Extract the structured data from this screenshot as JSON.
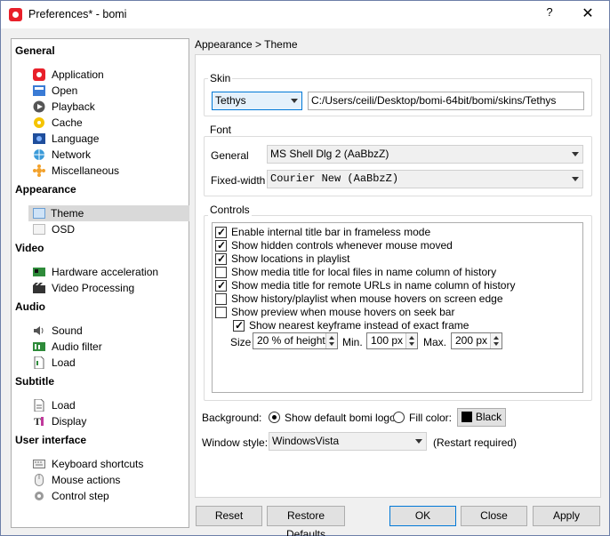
{
  "window": {
    "title": "Preferences* - bomi",
    "help_glyph": "?",
    "close_glyph": "✕"
  },
  "sidebar": {
    "sections": [
      {
        "label": "General",
        "items": [
          {
            "label": "Application",
            "icon": "application-icon"
          },
          {
            "label": "Open",
            "icon": "open-icon"
          },
          {
            "label": "Playback",
            "icon": "playback-icon"
          },
          {
            "label": "Cache",
            "icon": "cache-icon"
          },
          {
            "label": "Language",
            "icon": "language-icon"
          },
          {
            "label": "Network",
            "icon": "network-icon"
          },
          {
            "label": "Miscellaneous",
            "icon": "miscellaneous-icon"
          }
        ]
      },
      {
        "label": "Appearance",
        "items": [
          {
            "label": "Theme",
            "icon": "theme-icon",
            "selected": true
          },
          {
            "label": "OSD",
            "icon": "osd-icon"
          }
        ]
      },
      {
        "label": "Video",
        "items": [
          {
            "label": "Hardware acceleration",
            "icon": "hardware-acceleration-icon"
          },
          {
            "label": "Video Processing",
            "icon": "video-processing-icon"
          }
        ]
      },
      {
        "label": "Audio",
        "items": [
          {
            "label": "Sound",
            "icon": "sound-icon"
          },
          {
            "label": "Audio filter",
            "icon": "audio-filter-icon"
          },
          {
            "label": "Load",
            "icon": "audio-load-icon"
          }
        ]
      },
      {
        "label": "Subtitle",
        "items": [
          {
            "label": "Load",
            "icon": "subtitle-load-icon"
          },
          {
            "label": "Display",
            "icon": "subtitle-display-icon"
          }
        ]
      },
      {
        "label": "User interface",
        "items": [
          {
            "label": "Keyboard shortcuts",
            "icon": "keyboard-icon"
          },
          {
            "label": "Mouse actions",
            "icon": "mouse-icon"
          },
          {
            "label": "Control step",
            "icon": "control-step-icon"
          }
        ]
      }
    ]
  },
  "breadcrumb": "Appearance > Theme",
  "skin": {
    "group_title": "Skin",
    "selected": "Tethys",
    "path": "C:/Users/ceili/Desktop/bomi-64bit/bomi/skins/Tethys"
  },
  "font": {
    "group_title": "Font",
    "general_label": "General",
    "general_value": "MS Shell Dlg 2 (AaBbzZ)",
    "fixed_label": "Fixed-width",
    "fixed_value": "Courier New (AaBbzZ)"
  },
  "controls": {
    "group_title": "Controls",
    "options": [
      {
        "label": "Enable internal title bar in frameless mode",
        "checked": true
      },
      {
        "label": "Show hidden controls whenever mouse moved",
        "checked": true
      },
      {
        "label": "Show locations in playlist",
        "checked": true
      },
      {
        "label": "Show media title for local files in name column of history",
        "checked": false
      },
      {
        "label": "Show media title for remote URLs in name column of history",
        "checked": true
      },
      {
        "label": "Show history/playlist when mouse hovers on screen edge",
        "checked": false
      },
      {
        "label": "Show preview when mouse hovers on seek bar",
        "checked": false
      },
      {
        "label": "Show nearest keyframe instead of exact frame",
        "checked": true
      }
    ],
    "size_label": "Size",
    "size_value": "20 % of height",
    "min_label": "Min.",
    "min_value": "100 px",
    "max_label": "Max.",
    "max_value": "200 px"
  },
  "background": {
    "label": "Background:",
    "opt_default": "Show default bomi logo",
    "opt_fill": "Fill color:",
    "color_name": "Black",
    "color_hex": "#000000"
  },
  "window_style": {
    "label": "Window style:",
    "value": "WindowsVista",
    "note": "(Restart required)"
  },
  "buttons": {
    "reset": "Reset",
    "restore": "Restore Defaults",
    "ok": "OK",
    "close": "Close",
    "apply": "Apply"
  },
  "colors": {
    "accent": "#0078d7",
    "app_red": "#e8202a",
    "selection": "#d9d9d9"
  }
}
